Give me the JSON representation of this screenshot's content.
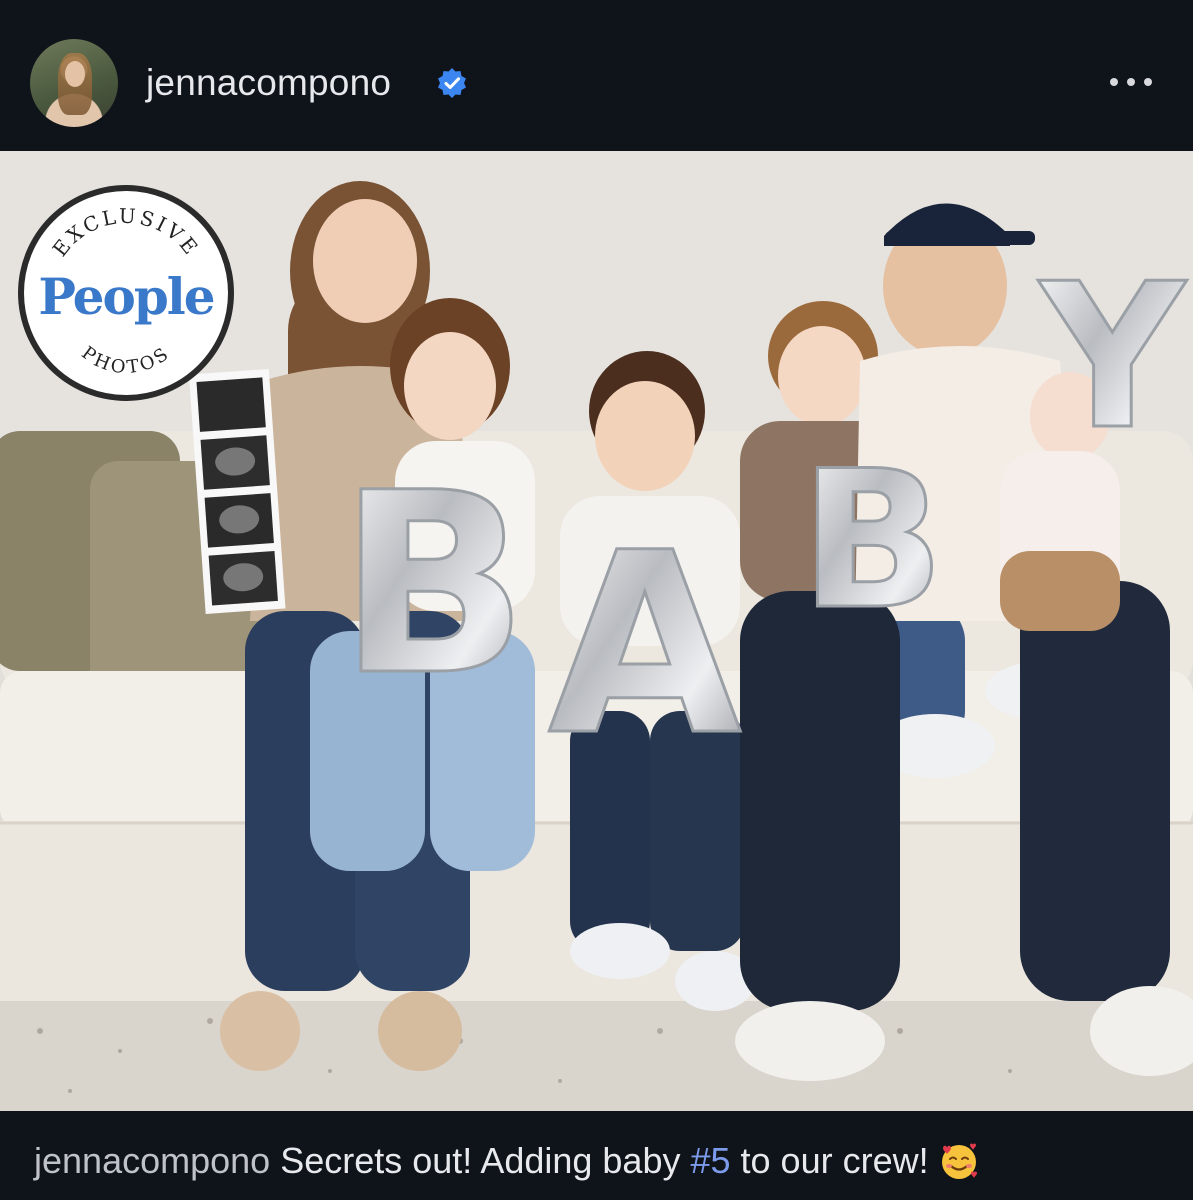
{
  "post": {
    "username": "jennacompono",
    "avatar_alt": "profile photo",
    "verified_icon": "verified-badge-icon",
    "more_icon": "more-options-icon",
    "photo": {
      "badge": {
        "top_text": "EXCLUSIVE",
        "brand": "People",
        "bottom_text": "PHOTOS"
      },
      "balloon_letters": [
        "B",
        "A",
        "B",
        "Y"
      ]
    },
    "caption": {
      "username": "jennacompono",
      "text_before": "Secrets out! Adding baby ",
      "hashtag": "#5",
      "text_after": " to our crew!",
      "emoji": "smiling-face-with-hearts-icon"
    }
  },
  "colors": {
    "background": "#0f131a",
    "verified": "#3b86f0",
    "hashtag": "#7c9bea",
    "people_blue": "#3a78c9"
  }
}
